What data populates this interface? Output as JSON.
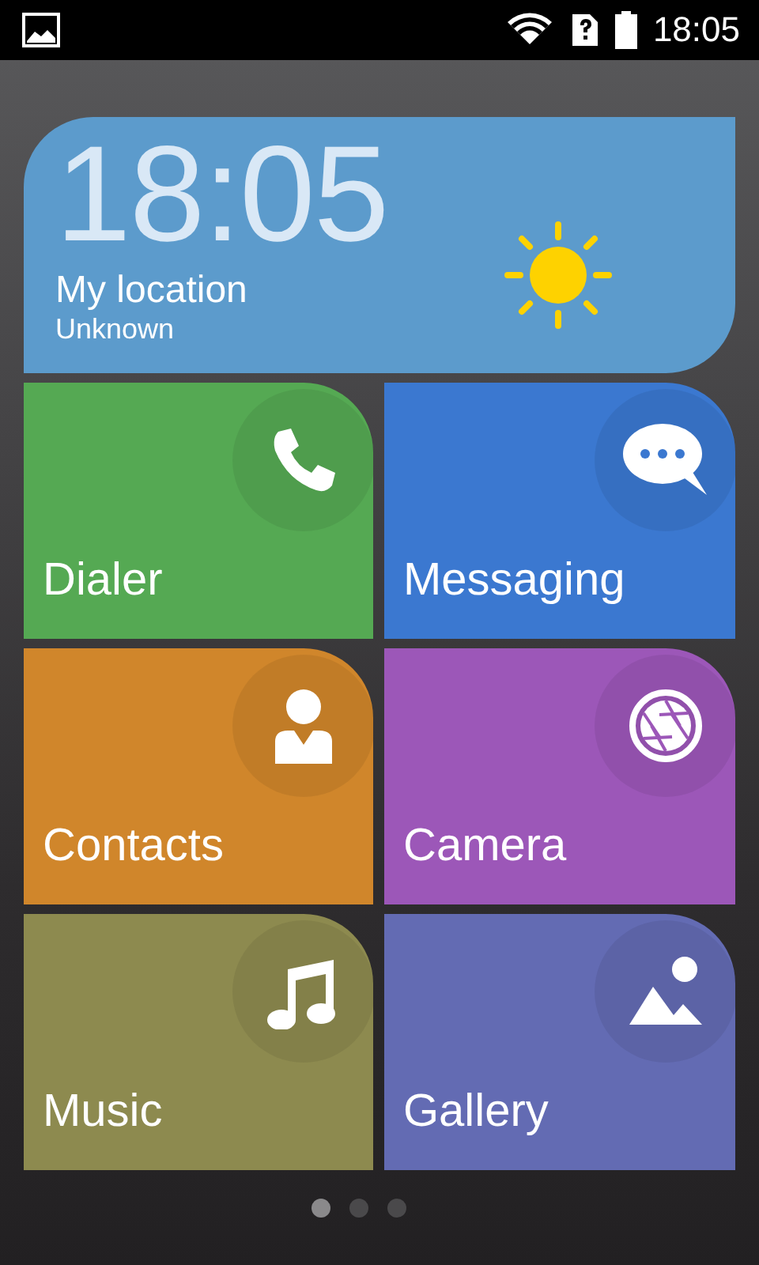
{
  "status_bar": {
    "time": "18:05"
  },
  "clock_widget": {
    "time": "18:05",
    "location": "My location",
    "place": "Unknown",
    "kind": "sunny"
  },
  "tiles": [
    {
      "label": "Dialer",
      "kind": "phone",
      "color": "#55a953"
    },
    {
      "label": "Messaging",
      "kind": "message",
      "color": "#3b78d0"
    },
    {
      "label": "Contacts",
      "kind": "contact",
      "color": "#d0862b"
    },
    {
      "label": "Camera",
      "kind": "camera",
      "color": "#9c57b8"
    },
    {
      "label": "Music",
      "kind": "music",
      "color": "#8d8a4f"
    },
    {
      "label": "Gallery",
      "kind": "gallery",
      "color": "#636bb3"
    }
  ],
  "page_dots": [
    {
      "selected": true
    },
    {
      "selected": false
    },
    {
      "selected": false
    }
  ]
}
